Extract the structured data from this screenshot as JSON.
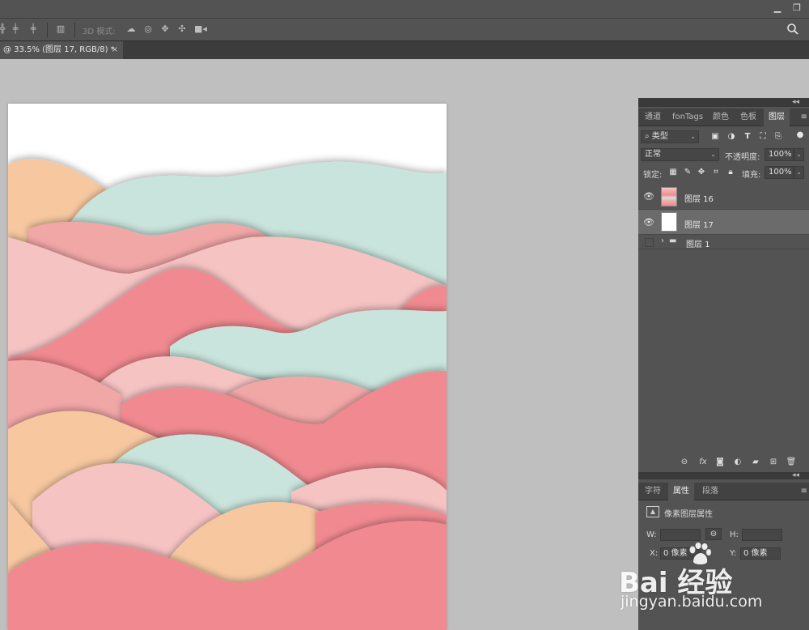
{
  "window": {
    "minimize_icon": "minimize-icon",
    "restore_icon": "restore-icon"
  },
  "options_bar": {
    "mode_3d_label": "3D 模式:",
    "icons": [
      "align-icon",
      "distribute-icon",
      "distribute-icon",
      "arrange-icon",
      "orbit-3d-icon",
      "roll-3d-icon",
      "drag-3d-icon",
      "slide-3d-icon",
      "camera-3d-icon"
    ],
    "search_icon": "search-icon"
  },
  "document_tab": {
    "title": "@ 33.5% (图层 17, RGB/8) *",
    "close_label": "×"
  },
  "colors": {
    "pink": "#f08a90",
    "light_pink": "#f6c3c3",
    "mint": "#c9e4dc",
    "peach": "#f7c8a0",
    "salmon": "#f2a7a7",
    "panel_bg": "#535353"
  },
  "layers_panel": {
    "tabs": [
      "通道",
      "fonTags",
      "颜色",
      "色板",
      "图层"
    ],
    "active_tab": "图层",
    "filter_kind": "类型",
    "blend_mode": "正常",
    "opacity_label": "不透明度:",
    "opacity_value": "100%",
    "lock_label": "锁定:",
    "fill_label": "填充:",
    "fill_value": "100%",
    "layers": [
      {
        "name": "图层 16",
        "visible": true,
        "selected": false
      },
      {
        "name": "图层 17",
        "visible": true,
        "selected": true
      },
      {
        "name": "图层 1",
        "visible": false,
        "selected": false,
        "type": "group"
      }
    ]
  },
  "properties_panel": {
    "tabs": [
      "字符",
      "属性",
      "段落"
    ],
    "active_tab": "属性",
    "header": "像素图层属性",
    "w_label": "W:",
    "h_label": "H:",
    "x_label": "X:",
    "x_value": "0 像素",
    "y_label": "Y:",
    "y_value": "0 像素"
  },
  "watermark": {
    "brand": "Bai 经验",
    "url": "jingyan.baidu.com"
  }
}
